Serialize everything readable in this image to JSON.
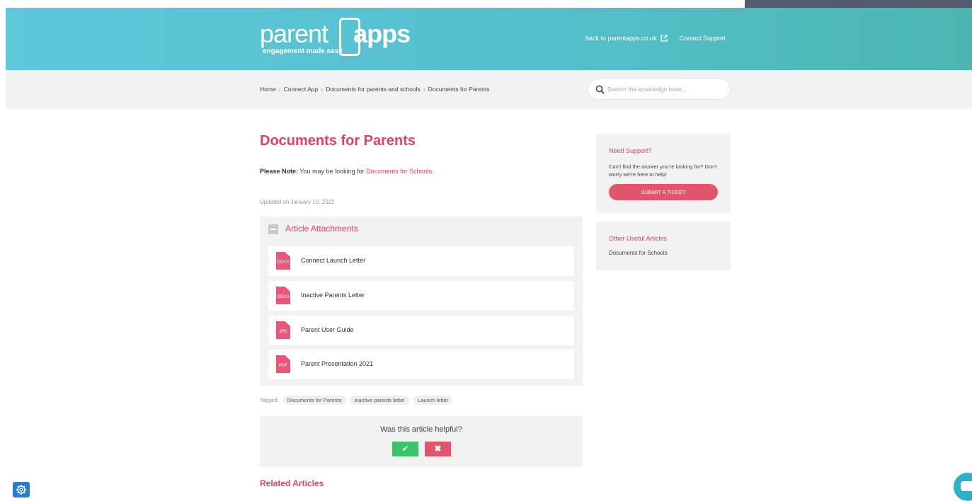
{
  "header": {
    "logo_text_light": "parent",
    "logo_text_bold": "apps",
    "logo_tagline": "engagement made easy",
    "back_link": "back to parentapps.co.uk",
    "contact_link": "Contact Support"
  },
  "breadcrumb": {
    "items": [
      "Home",
      "Connect App",
      "Documents for parents and schools",
      "Documents for Parents"
    ],
    "separator": "›"
  },
  "search": {
    "placeholder": "Search the knowledge base..."
  },
  "article": {
    "title": "Documents for Parents",
    "note_label": "Please Note:",
    "note_text": "You may be looking for",
    "note_link": "Documents for Schools",
    "note_end": ".",
    "updated": "Updated on January 10, 2022",
    "attachments_title": "Article Attachments",
    "attachments": [
      {
        "ext": "DOCX",
        "name": "Connect Launch Letter"
      },
      {
        "ext": "DOCX",
        "name": "Inactive Parents Letter"
      },
      {
        "ext": "JPG",
        "name": "Parent User Guide"
      },
      {
        "ext": "PDF",
        "name": "Parent Presentation 2021"
      }
    ],
    "tagged_label": "Tagged:",
    "tags": [
      "Documents for Parents",
      "inactive parents letter",
      "Launch letter"
    ],
    "helpful_question": "Was this article helpful?",
    "yes_symbol": "✔",
    "no_symbol": "✖",
    "related_title": "Related Articles"
  },
  "sidebar": {
    "support_title": "Need Support?",
    "support_text": "Can't find the answer you're looking for? Don't worry we're here to help!",
    "submit_label": "SUBMIT A TICKET",
    "useful_title": "Other Useful Articles",
    "useful_links": [
      "Documents for Schools"
    ]
  },
  "colors": {
    "accent": "#e2416a",
    "header_start": "#5ec7da",
    "header_end": "#4bb6b0",
    "yes": "#3cc36a",
    "no": "#e1566b"
  },
  "icons": [
    "external-link-icon",
    "search-icon",
    "collapse-icon",
    "file-icon",
    "gear-icon",
    "chat-icon"
  ]
}
